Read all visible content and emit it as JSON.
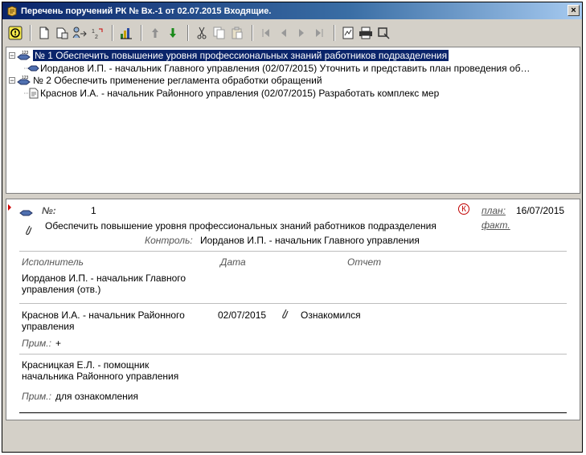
{
  "window": {
    "title": "Перечень поручений РК № Вх.-1 от 02.07.2015 Входящие.",
    "close_label": "×"
  },
  "toolbar": {
    "buttons": [
      "info-icon",
      "new-doc-icon",
      "save-doc-icon",
      "assign-icon",
      "sort-icon",
      "chart-icon",
      "arrow-up-icon",
      "arrow-down-icon",
      "cut-icon",
      "copy-icon",
      "paste-icon",
      "first-icon",
      "prev-icon",
      "next-icon",
      "last-icon",
      "report-icon",
      "print-icon",
      "select-icon"
    ]
  },
  "tree": {
    "nodes": [
      {
        "level": 0,
        "expander": "−",
        "badge": "123",
        "text": "№ 1 Обеспечить повышение уровня профессиональных знаний работников подразделения",
        "selected": true
      },
      {
        "level": 1,
        "expander": "",
        "badge": "",
        "text": "Иорданов И.П. - начальник Главного управления (02/07/2015) Уточнить и представить план проведения об…",
        "selected": false
      },
      {
        "level": 0,
        "expander": "−",
        "badge": "123",
        "text": "№ 2 Обеспечить применение регламента обработки обращений",
        "selected": false
      },
      {
        "level": 1,
        "expander": "",
        "badge": "",
        "text": "Краснов И.А. - начальник Районного управления (02/07/2015) Разработать комплекс мер",
        "selected": false
      }
    ]
  },
  "detail": {
    "num_label": "№:",
    "num_value": "1",
    "control_flag": "К",
    "plan_label": "план:",
    "plan_value": "16/07/2015",
    "fact_label": "факт.",
    "task_text": "Обеспечить повышение уровня профессиональных знаний работников подразделения",
    "control_label": "Контроль:",
    "control_value": "Иорданов И.П. - начальник Главного управления",
    "columns": {
      "executor": "Исполнитель",
      "date": "Дата",
      "report": "Отчет"
    },
    "rows": [
      {
        "executor_line1": "Иорданов И.П. - начальник Главного",
        "executor_line2": "управления (отв.)",
        "date": "",
        "report": "",
        "note_label": "",
        "note": ""
      },
      {
        "executor_line1": "Краснов И.А. - начальник Районного",
        "executor_line2": "управления",
        "date": "02/07/2015",
        "report": "Ознакомился",
        "note_label": "Прим.:",
        "note": "+"
      },
      {
        "executor_line1": "Красницкая Е.Л. - помощник",
        "executor_line2": "начальника Районного управления",
        "date": "",
        "report": "",
        "note_label": "Прим.:",
        "note": "для ознакомления"
      }
    ]
  },
  "colors": {
    "title_start": "#0a246a",
    "title_end": "#a6caf0",
    "selection": "#0a246a",
    "control_flag": "#c00000"
  }
}
